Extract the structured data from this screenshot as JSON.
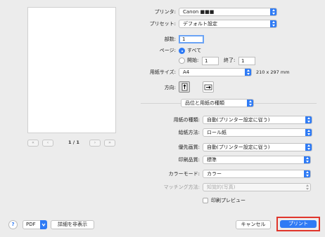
{
  "preview": {
    "page_indicator": "1 / 1",
    "first_label": "«",
    "prev_label": "‹",
    "next_label": "›",
    "last_label": "»"
  },
  "printer": {
    "label": "プリンタ:",
    "value": "Canon ■■■"
  },
  "preset": {
    "label": "プリセット:",
    "value": "デフォルト設定"
  },
  "copies": {
    "label": "部数:",
    "value": "1"
  },
  "pages": {
    "label": "ページ:",
    "all_label": "すべて",
    "from_label": "開始:",
    "from_value": "1",
    "to_label": "終了:",
    "to_value": "1",
    "selected": "all"
  },
  "paper_size": {
    "label": "用紙サイズ:",
    "value": "A4",
    "dimensions": "210 x 297 mm"
  },
  "orientation": {
    "label": "方向:",
    "selected": "portrait"
  },
  "section": {
    "value": "品位と用紙の種類"
  },
  "media_type": {
    "label": "用紙の種類:",
    "value": "自動(プリンター設定に従う)"
  },
  "paper_source": {
    "label": "給紙方法:",
    "value": "ロール紙"
  },
  "print_priority": {
    "label": "優先画質:",
    "value": "自動(プリンター設定に従う)"
  },
  "print_quality": {
    "label": "印刷品質:",
    "value": "標準"
  },
  "color_mode": {
    "label": "カラーモード:",
    "value": "カラー"
  },
  "matching": {
    "label": "マッチング方法:",
    "value": "知覚的(写真)"
  },
  "print_preview": {
    "label": "印刷プレビュー",
    "checked": false
  },
  "footer": {
    "help_label": "?",
    "pdf_label": "PDF",
    "hide_details_label": "詳細を非表示",
    "cancel_label": "キャンセル",
    "print_label": "プリント"
  },
  "colors": {
    "accent": "#2f7bf5",
    "highlight": "#e0352b"
  }
}
